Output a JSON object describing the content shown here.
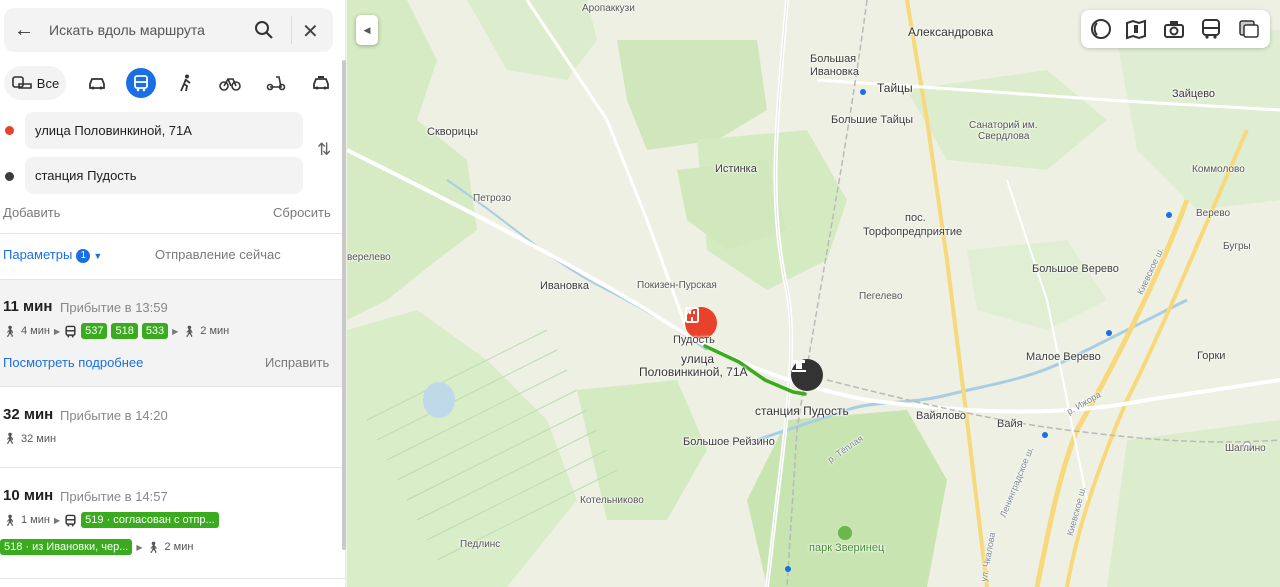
{
  "search": {
    "placeholder": "Искать вдоль маршрута"
  },
  "modes": {
    "all_label": "Все",
    "active": "bus"
  },
  "points": {
    "from": "улица Половинкиной, 71А",
    "to": "станция Пудость",
    "from_color": "#e8412c",
    "to_color": "#3c3c3c"
  },
  "actions": {
    "add": "Добавить",
    "reset": "Сбросить"
  },
  "params": {
    "label": "Параметры",
    "count": "1",
    "departure": "Отправление сейчас"
  },
  "routes": [
    {
      "time": "11 мин",
      "arrival": "Прибытие в 13:59",
      "walk1": "4 мин",
      "buses": [
        "537",
        "518",
        "533"
      ],
      "walk2": "2 мин",
      "details": "Посмотреть подробнее",
      "fix": "Исправить"
    },
    {
      "time": "32 мин",
      "arrival": "Прибытие в 14:20",
      "walk1": "32 мин"
    },
    {
      "time": "10 мин",
      "arrival": "Прибытие в 14:57",
      "walk1": "1 мин",
      "bus1": "519 · согласован с отпр...",
      "bus2": "518 · из Ивановки, чер...",
      "walk2": "2 мин"
    }
  ],
  "map": {
    "labels": {
      "aropakkuzi": "Аропаккузи",
      "aleksandrovka": "Александровка",
      "bolshaya_ivanovka_1": "Большая",
      "bolshaya_ivanovka_2": "Ивановка",
      "taitsy": "Тайцы",
      "zaitsevo": "Зайцево",
      "skvoritsy": "Скворицы",
      "bolshie_taitsy": "Большие Тайцы",
      "sanatorium_1": "Санаторий им.",
      "sanatorium_2": "Свердлова",
      "kommolovo": "Коммолово",
      "istinka": "Истинка",
      "petrozo": "Петрозо",
      "pos": "пос.",
      "torfopredpriyatie": "Торфопредприятие",
      "verevo": "Верево",
      "bugry": "Бугры",
      "verelevo": "верелево",
      "bolshoe_verevo": "Большое Верево",
      "ivanovka": "Ивановка",
      "pokizen": "Покизен-Пурская",
      "pegelevo": "Пегелево",
      "pudost": "Пудость",
      "street_1": "улица",
      "street_2": "Половинкиной, 71А",
      "maloe_verevo": "Малое Верево",
      "gorki": "Горки",
      "station": "станция Пудость",
      "vaiyalovo": "Вайялово",
      "vaiya": "Вайя",
      "bolshoe_reizino": "Большое Рейзино",
      "shaglino": "Шаглино",
      "kotelnikovo": "Котельниково",
      "pedlins": "Педлинс",
      "park": "парк Зверинец",
      "river_izhora": "р. Ижора",
      "river_teplaya": "р. Тёплая",
      "road_leningradskoe": "Ленинградское ш.",
      "road_kievskoe_1": "Киевское ш.",
      "road_kievskoe_2": "Киевское ш.",
      "road_chkalova": "ул. Чкалова"
    },
    "route_color": "#3aaa1e",
    "origin_pin_color": "#e8412c",
    "station_pin_color": "#333333"
  }
}
